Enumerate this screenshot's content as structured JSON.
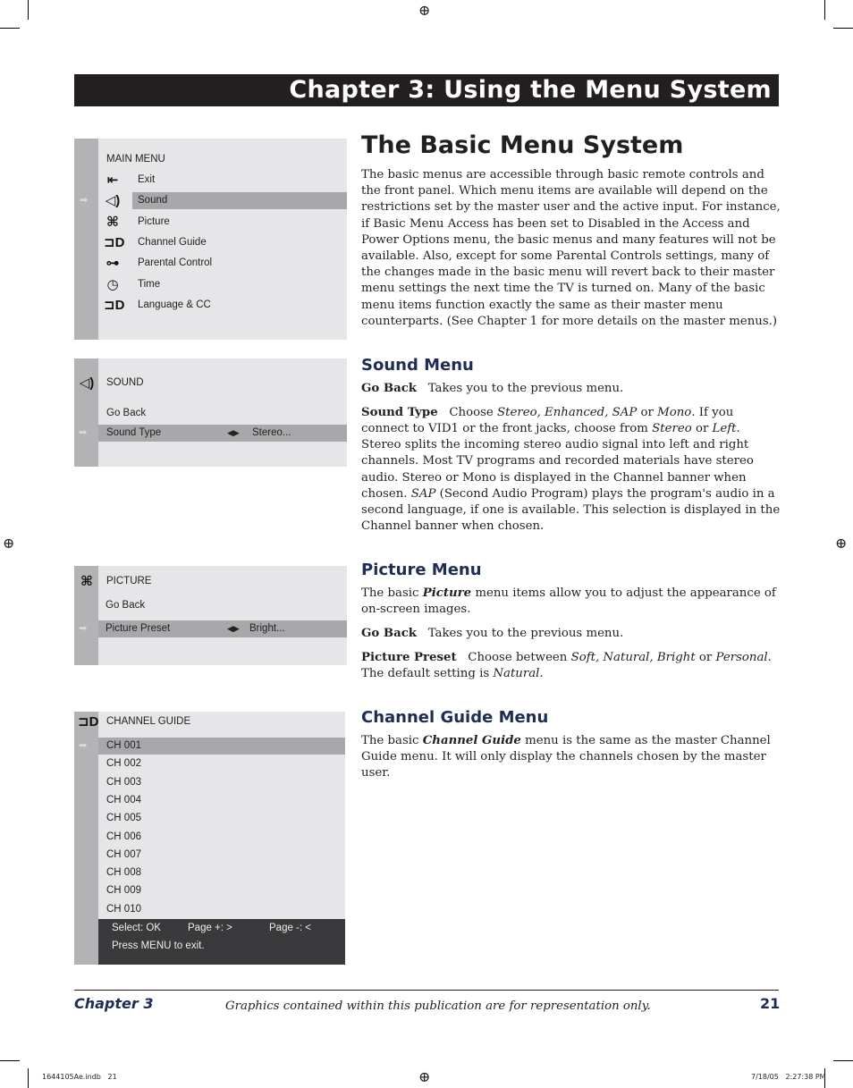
{
  "chapter_header": "Chapter 3: Using the Menu System",
  "page_title": "The Basic Menu System",
  "intro": "The basic menus are accessible through basic remote controls and the front panel. Which menu items are available will depend on the restrictions set by the master user and the active input. For instance, if Basic Menu Access has been set to Disabled in the Access and Power Options menu, the basic menus and many features will not be available. Also, except for some Parental Controls settings, many of the changes made in the basic menu will revert back to their master menu settings the next time the TV is turned on. Many of the basic menu items function exactly the same as their master menu counterparts. (See Chapter 1 for more details on the master menus.)",
  "main_menu": {
    "title": "MAIN MENU",
    "items": [
      {
        "label": "Exit",
        "icon": "back-arrow-icon"
      },
      {
        "label": "Sound",
        "icon": "speaker-icon",
        "selected": true
      },
      {
        "label": "Picture",
        "icon": "picture-icon"
      },
      {
        "label": "Channel Guide",
        "icon": "plug-icon"
      },
      {
        "label": "Parental Control",
        "icon": "key-icon"
      },
      {
        "label": "Time",
        "icon": "clock-icon"
      },
      {
        "label": "Language & CC",
        "icon": "plug-icon"
      }
    ]
  },
  "sound_menu": {
    "title": "SOUND",
    "go_back": "Go Back",
    "item": "Sound Type",
    "value": "Stereo..."
  },
  "picture_menu": {
    "title": "PICTURE",
    "go_back": "Go Back",
    "item": "Picture Preset",
    "value": "Bright..."
  },
  "channel_menu": {
    "title": "CHANNEL GUIDE",
    "channels": [
      "CH 001",
      "CH 002",
      "CH 003",
      "CH 004",
      "CH 005",
      "CH 006",
      "CH 007",
      "CH 008",
      "CH 009",
      "CH 010"
    ],
    "select": "Select: OK",
    "page_plus": "Page +: >",
    "page_minus": "Page -: <",
    "exit_hint": "Press MENU to exit."
  },
  "sections": {
    "sound": {
      "heading": "Sound Menu",
      "paragraphs": [
        [
          [
            "Go Back",
            "b"
          ],
          [
            "   Takes you to the previous menu.",
            ""
          ]
        ],
        [
          [
            "Sound Type",
            "b"
          ],
          [
            "   Choose ",
            ""
          ],
          [
            "Stereo, Enhanced, SAP",
            "i"
          ],
          [
            " or ",
            ""
          ],
          [
            "Mono",
            "i"
          ],
          [
            ". If you connect to VID1 or the front jacks, choose from ",
            ""
          ],
          [
            "Stereo",
            "i"
          ],
          [
            " or ",
            ""
          ],
          [
            "Left",
            "i"
          ],
          [
            ". Stereo splits the incoming stereo audio signal into left and right channels. Most TV programs and recorded materials have stereo audio. Stereo or Mono is displayed in the Channel banner when chosen. ",
            ""
          ],
          [
            "SAP",
            "i"
          ],
          [
            " (Second Audio Program) plays the program's audio in a second language, if one is available. This selection is displayed in the Channel banner when chosen.",
            ""
          ]
        ]
      ]
    },
    "picture": {
      "heading": "Picture Menu",
      "paragraphs": [
        [
          [
            "The basic ",
            ""
          ],
          [
            "Picture",
            "bi"
          ],
          [
            " menu items allow you to adjust the appearance of on-screen images.",
            ""
          ]
        ],
        [
          [
            "Go Back",
            "b"
          ],
          [
            "   Takes you to the previous menu.",
            ""
          ]
        ],
        [
          [
            "Picture Preset",
            "b"
          ],
          [
            "   Choose between ",
            ""
          ],
          [
            "Soft, Natural, Bright",
            "i"
          ],
          [
            " or ",
            ""
          ],
          [
            "Personal",
            "i"
          ],
          [
            ". The default setting is ",
            ""
          ],
          [
            "Natural",
            "i"
          ],
          [
            ".",
            ""
          ]
        ]
      ]
    },
    "channel": {
      "heading": "Channel Guide Menu",
      "paragraphs": [
        [
          [
            "The basic ",
            ""
          ],
          [
            "Channel Guide",
            "bi"
          ],
          [
            " menu is the same as the master Channel Guide menu. It will only display the channels chosen by the master user.",
            ""
          ]
        ]
      ]
    }
  },
  "footer": {
    "chapter": "Chapter 3",
    "disclaimer": "Graphics contained within this publication are for representation only.",
    "page_number": "21"
  },
  "slug": {
    "file": "1644105Ae.indb   21",
    "timestamp": "7/18/05   2:27:38 PM"
  }
}
